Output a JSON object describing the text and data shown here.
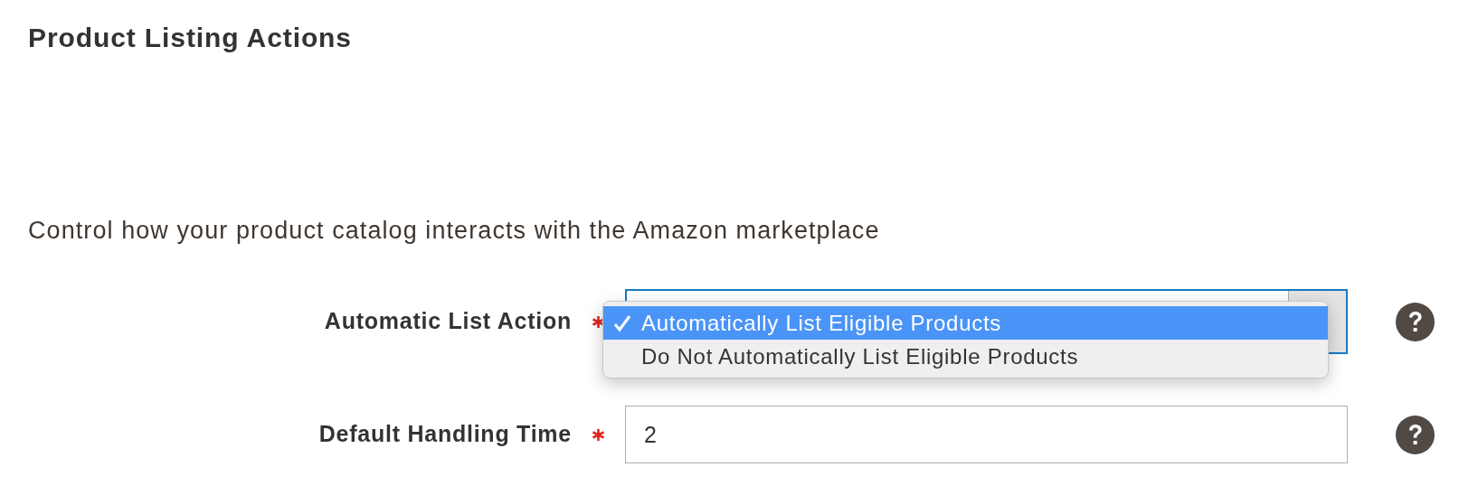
{
  "title": "Product Listing Actions",
  "description": "Control how your product catalog interacts with the Amazon marketplace",
  "fields": [
    {
      "kind": "select",
      "label": "Automatic List Action",
      "required": true,
      "expanded": true,
      "options": [
        {
          "label": "Automatically List Eligible Products",
          "selected": true
        },
        {
          "label": "Do Not Automatically List Eligible Products",
          "selected": false
        }
      ]
    },
    {
      "kind": "text",
      "label": "Default Handling Time",
      "required": true,
      "value": "2"
    }
  ]
}
